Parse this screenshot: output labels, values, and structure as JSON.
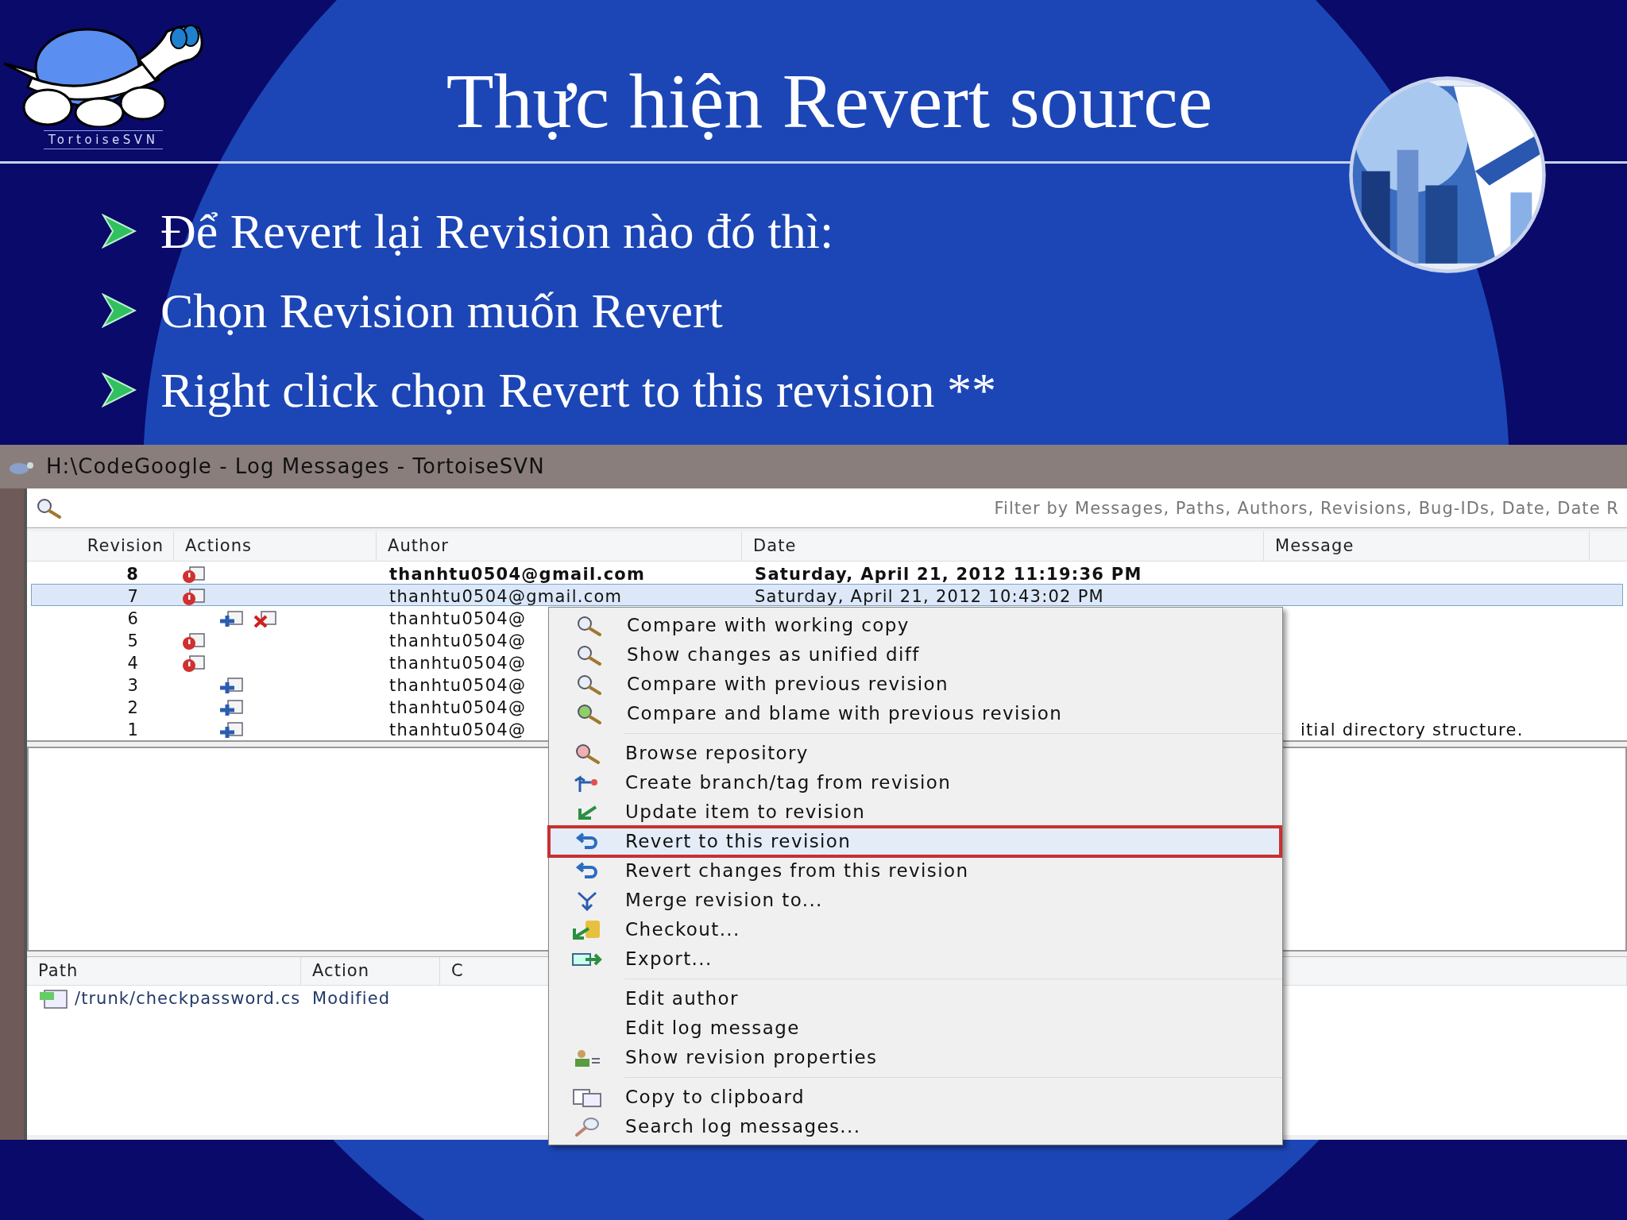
{
  "slide": {
    "logo_text": "TortoiseSVN",
    "title": "Thực hiện Revert source",
    "bullets": [
      "Để Revert lại Revision nào đó thì:",
      "Chọn Revision muốn Revert",
      "Right click chọn Revert to this revision  **"
    ]
  },
  "window": {
    "title": "H:\\CodeGoogle - Log Messages - TortoiseSVN",
    "filter": {
      "placeholder": "Filter by Messages, Paths, Authors, Revisions, Bug-IDs, Date, Date R"
    },
    "log": {
      "columns": [
        "Revision",
        "Actions",
        "Author",
        "Date",
        "Message"
      ],
      "rows": [
        {
          "revision": "8",
          "actions": [
            {
              "kind": "modified"
            }
          ],
          "author": "thanhtu0504@gmail.com",
          "date": "Saturday, April 21, 2012 11:19:36 PM",
          "bold": true,
          "selected": false
        },
        {
          "revision": "7",
          "actions": [
            {
              "kind": "modified"
            }
          ],
          "author": "thanhtu0504@gmail.com",
          "date": "Saturday, April 21, 2012 10:43:02 PM",
          "bold": false,
          "selected": true
        },
        {
          "revision": "6",
          "actions": [
            {
              "kind": "added"
            },
            {
              "kind": "deleted"
            }
          ],
          "author": "thanhtu0504@",
          "bold": false,
          "selected": false
        },
        {
          "revision": "5",
          "actions": [
            {
              "kind": "modified"
            }
          ],
          "author": "thanhtu0504@",
          "bold": false,
          "selected": false
        },
        {
          "revision": "4",
          "actions": [
            {
              "kind": "modified"
            }
          ],
          "author": "thanhtu0504@",
          "bold": false,
          "selected": false
        },
        {
          "revision": "3",
          "actions": [
            {
              "kind": "added"
            }
          ],
          "author": "thanhtu0504@",
          "bold": false,
          "selected": false
        },
        {
          "revision": "2",
          "actions": [
            {
              "kind": "added"
            }
          ],
          "author": "thanhtu0504@",
          "bold": false,
          "selected": false
        },
        {
          "revision": "1",
          "actions": [
            {
              "kind": "added"
            }
          ],
          "author": "thanhtu0504@",
          "message": "itial directory structure.",
          "bold": false,
          "selected": false
        }
      ]
    },
    "files": {
      "columns": [
        "Path",
        "Action",
        "C"
      ],
      "rows": [
        {
          "path": "/trunk/checkpassword.cs",
          "action": "Modified"
        }
      ]
    },
    "context_menu": {
      "groups": [
        [
          {
            "label": "Compare with working copy",
            "selected": false
          },
          {
            "label": "Show changes as unified diff",
            "selected": false
          },
          {
            "label": "Compare with previous revision",
            "selected": false
          },
          {
            "label": "Compare and blame with previous revision",
            "selected": false
          }
        ],
        [
          {
            "label": "Browse repository",
            "selected": false
          },
          {
            "label": "Create branch/tag from revision",
            "selected": false
          },
          {
            "label": "Update item to revision",
            "selected": false
          },
          {
            "label": "Revert to this revision",
            "selected": true
          },
          {
            "label": "Revert changes from this revision",
            "selected": false
          },
          {
            "label": "Merge revision to...",
            "selected": false
          },
          {
            "label": "Checkout...",
            "selected": false
          },
          {
            "label": "Export...",
            "selected": false
          }
        ],
        [
          {
            "label": "Edit author",
            "selected": false
          },
          {
            "label": "Edit log message",
            "selected": false
          },
          {
            "label": "Show revision properties",
            "selected": false
          }
        ],
        [
          {
            "label": "Copy to clipboard",
            "selected": false
          },
          {
            "label": "Search log messages...",
            "selected": false
          }
        ]
      ]
    }
  }
}
